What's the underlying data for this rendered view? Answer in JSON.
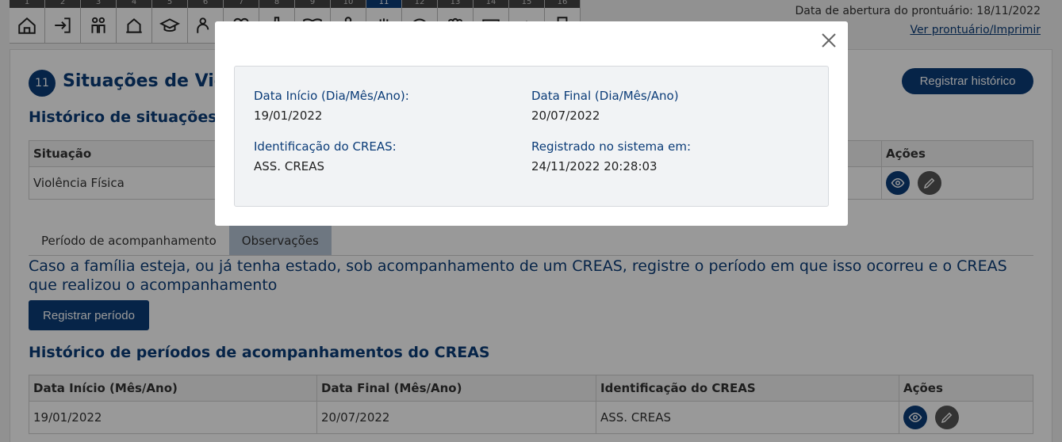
{
  "tabs": {
    "numbers": [
      "1",
      "2",
      "3",
      "4",
      "5",
      "6",
      "7",
      "8",
      "9",
      "10",
      "11",
      "12",
      "13",
      "14",
      "15",
      "16"
    ],
    "active_index": 10,
    "icons": [
      "home-icon",
      "login-icon",
      "family-icon",
      "house-hand-icon",
      "graduation-cap-icon",
      "person-hand-icon",
      "heart-icon",
      "bottle-icon",
      "book-open-icon",
      "person-icon",
      "hand-icon",
      "eye-icon",
      "group-icon",
      "card-icon",
      "up-icon",
      "door-icon"
    ]
  },
  "header": {
    "opening_date": "Data de abertura do prontuário: 18/11/2022",
    "view_link": "Ver prontuário/Imprimir"
  },
  "section": {
    "number": "11",
    "title": "Situações de Violência",
    "register_history": "Registrar histórico"
  },
  "history": {
    "heading": "Histórico de situações de violência",
    "headers": {
      "situacao": "Situação",
      "acoes": "Ações"
    },
    "rows": [
      {
        "situacao": "Violência Física"
      }
    ]
  },
  "subtabs": [
    "Período de acompanhamento",
    "Observações"
  ],
  "info_text": "Caso a família esteja, ou já tenha estado, sob acompanhamento de um CREAS, registre o período em que isso ocorreu e o CREAS que realizou o acompanhamento",
  "register_period": "Registrar período",
  "creas_history": {
    "heading": "Histórico de períodos de acompanhamentos do CREAS",
    "headers": [
      "Data Início (Mês/Ano)",
      "Data Final (Mês/Ano)",
      "Identificação do CREAS",
      "Ações"
    ],
    "rows": [
      [
        "19/01/2022",
        "20/07/2022",
        "ASS. CREAS"
      ]
    ]
  },
  "modal": {
    "start_label": "Data Início (Dia/Mês/Ano):",
    "start_value": "19/01/2022",
    "end_label": "Data Final (Dia/Mês/Ano)",
    "end_value": "20/07/2022",
    "creas_label": "Identificação do CREAS:",
    "creas_value": "ASS. CREAS",
    "registered_label": "Registrado no sistema em:",
    "registered_value": "24/11/2022 20:28:03"
  },
  "colors": {
    "primary": "#0b3c78",
    "overlay": "rgba(0,0,0,0.4)",
    "selected_tab": "#b8c6d8"
  }
}
